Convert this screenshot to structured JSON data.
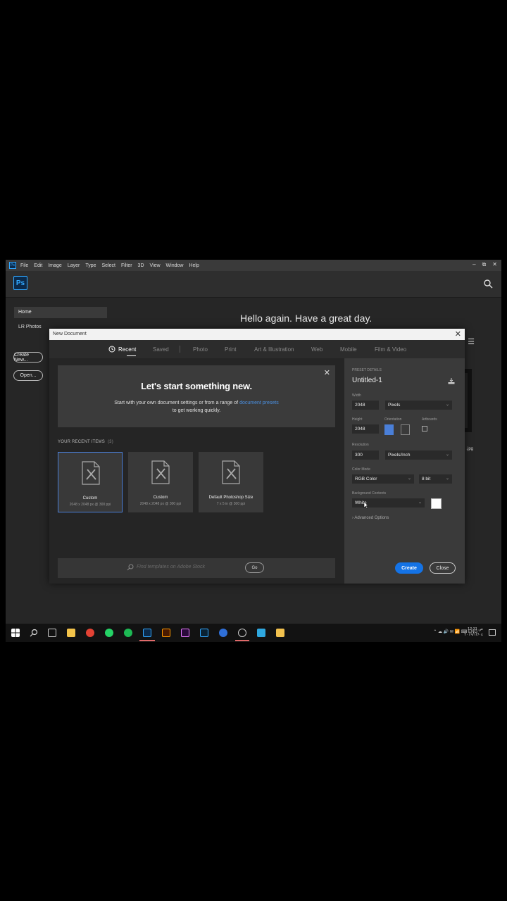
{
  "menubar": {
    "app_icon": "Ps",
    "items": [
      "File",
      "Edit",
      "Image",
      "Layer",
      "Type",
      "Select",
      "Filter",
      "3D",
      "View",
      "Window",
      "Help"
    ],
    "controls": [
      "–",
      "⧉",
      "✕"
    ]
  },
  "header": {
    "logo": "Ps",
    "search_icon": "search-icon"
  },
  "home": {
    "nav_home": "Home",
    "nav_lr": "LR Photos",
    "create_new": "Create New...",
    "open": "Open...",
    "greeting": "Hello again. Have a great day.",
    "file_ext": ".jpg"
  },
  "dialog": {
    "title": "New Document",
    "tabs": [
      "Recent",
      "Saved",
      "Photo",
      "Print",
      "Art & Illustration",
      "Web",
      "Mobile",
      "Film & Video"
    ],
    "active_tab": "Recent",
    "welcome": {
      "title": "Let's start something new.",
      "line1_prefix": "Start with your own document settings or from a range of",
      "line1_link": "document presets",
      "line2": "to get working quickly."
    },
    "recent_label": "YOUR RECENT ITEMS",
    "recent_count": "(3)",
    "recent_items": [
      {
        "name": "Custom",
        "meta": "2048 x 2048 px @ 300 ppi"
      },
      {
        "name": "Custom",
        "meta": "2048 x 2048 px @ 300 ppi"
      },
      {
        "name": "Default Photoshop Size",
        "meta": "7 x 5 in @ 300 ppi"
      }
    ],
    "stock_placeholder": "Find templates on Adobe Stock",
    "go": "Go",
    "preset": {
      "section": "PRESET DETAILS",
      "name": "Untitled-1",
      "width_label": "Width",
      "width": "2048",
      "width_unit": "Pixels",
      "height_label": "Height",
      "height": "2048",
      "orientation_label": "Orientation",
      "artboards_label": "Artboards",
      "resolution_label": "Resolution",
      "resolution": "300",
      "resolution_unit": "Pixels/Inch",
      "color_mode_label": "Color Mode",
      "color_mode": "RGB Color",
      "bit_depth": "8 bit",
      "background_label": "Background Contents",
      "background": "White",
      "advanced": "Advanced Options"
    },
    "create": "Create",
    "close": "Close"
  },
  "taskbar": {
    "tray": "ENG",
    "time": "12:31 ص",
    "date": "٢٠١٩/١٢/٠٤"
  },
  "colors": {
    "accent": "#1473e6",
    "ps_blue": "#31a8ff",
    "link": "#4a90e2"
  }
}
